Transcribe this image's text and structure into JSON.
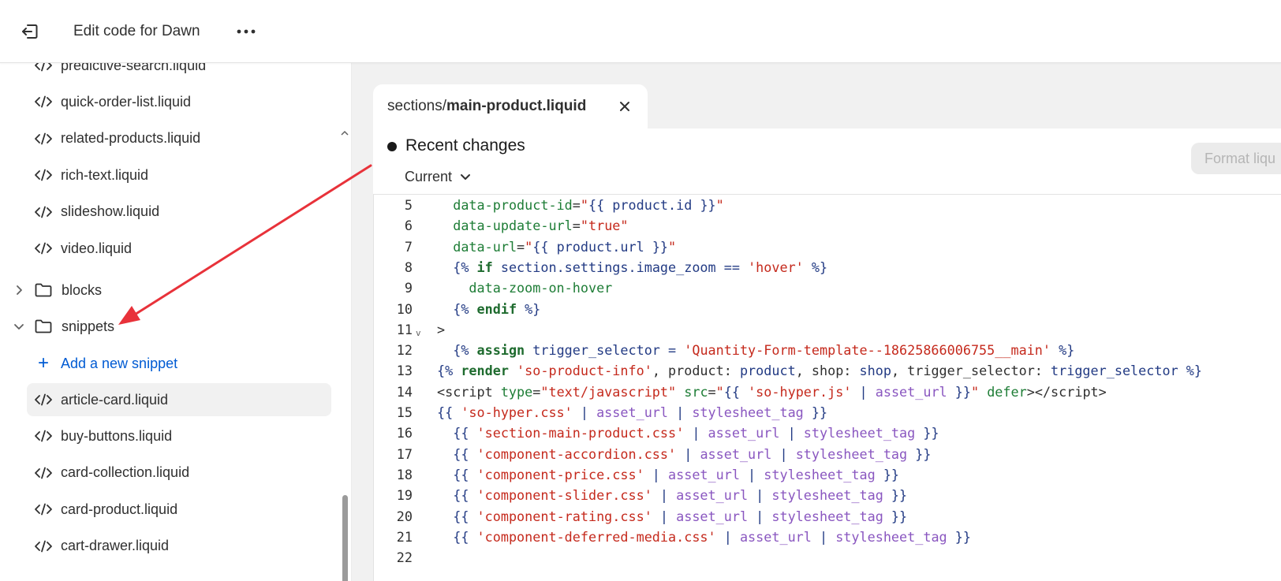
{
  "header": {
    "title": "Edit code for Dawn"
  },
  "sidebar": {
    "files_top": [
      "predictive-search.liquid",
      "quick-order-list.liquid",
      "related-products.liquid",
      "rich-text.liquid",
      "slideshow.liquid",
      "video.liquid"
    ],
    "folders": [
      {
        "name": "blocks",
        "state": "collapsed"
      },
      {
        "name": "snippets",
        "state": "expanded"
      }
    ],
    "add_snippet_label": "Add a new snippet",
    "snippet_files": [
      "article-card.liquid",
      "buy-buttons.liquid",
      "card-collection.liquid",
      "card-product.liquid",
      "cart-drawer.liquid"
    ],
    "selected_file": "article-card.liquid"
  },
  "tab": {
    "dir": "sections/",
    "file": "main-product.liquid"
  },
  "changes": {
    "title": "Recent changes",
    "version": "Current",
    "format_button": "Format liqu"
  },
  "code_lines": [
    {
      "n": "5",
      "fold": "",
      "html": "  <span class=\"t-attr\">data-product-id</span>=<span class=\"t-str\">\"</span><span class=\"t-liq\">{{ product.id }}</span><span class=\"t-str\">\"</span>"
    },
    {
      "n": "6",
      "fold": "",
      "html": "  <span class=\"t-attr\">data-update-url</span>=<span class=\"t-str\">\"true\"</span>"
    },
    {
      "n": "7",
      "fold": "",
      "html": "  <span class=\"t-attr\">data-url</span>=<span class=\"t-str\">\"</span><span class=\"t-liq\">{{ product.url }}</span><span class=\"t-str\">\"</span>"
    },
    {
      "n": "8",
      "fold": "",
      "html": "  <span class=\"t-liq\">{% </span><span class=\"t-kw\">if</span><span class=\"t-liq\"> section.settings.image_zoom == </span><span class=\"t-str\">'hover'</span><span class=\"t-liq\"> %}</span>"
    },
    {
      "n": "9",
      "fold": "",
      "html": "    <span class=\"t-attr\">data-zoom-on-hover</span>"
    },
    {
      "n": "10",
      "fold": "",
      "html": "  <span class=\"t-liq\">{% </span><span class=\"t-kw\">endif</span><span class=\"t-liq\"> %}</span>"
    },
    {
      "n": "11",
      "fold": "v",
      "html": "<span class=\"t-txt\">&gt;</span>"
    },
    {
      "n": "12",
      "fold": "",
      "html": "  <span class=\"t-liq\">{% </span><span class=\"t-kw\">assign</span><span class=\"t-liq\"> trigger_selector = </span><span class=\"t-str\">'Quantity-Form-template--18625866006755__main'</span><span class=\"t-liq\"> %}</span>"
    },
    {
      "n": "13",
      "fold": "",
      "html": "<span class=\"t-liq\">{% </span><span class=\"t-kw\">render</span> <span class=\"t-str\">'so-product-info'</span><span class=\"t-txt\">, product: </span><span class=\"t-liq\">product</span><span class=\"t-txt\">, shop: </span><span class=\"t-liq\">shop</span><span class=\"t-txt\">, trigger_selector: </span><span class=\"t-liq\">trigger_selector %}</span>"
    },
    {
      "n": "14",
      "fold": "",
      "html": "<span class=\"t-txt\">&lt;script </span><span class=\"t-attr\">type</span>=<span class=\"t-str\">\"text/javascript\"</span> <span class=\"t-attr\">src</span>=<span class=\"t-str\">\"</span><span class=\"t-liq\">{{ </span><span class=\"t-str\">'so-hyper.js'</span><span class=\"t-liq\"> | </span><span class=\"t-filter\">asset_url</span><span class=\"t-liq\"> }}</span><span class=\"t-str\">\"</span> <span class=\"t-attr\">defer</span><span class=\"t-txt\">&gt;&lt;/script&gt;</span>"
    },
    {
      "n": "15",
      "fold": "",
      "html": "<span class=\"t-liq\">{{ </span><span class=\"t-str\">'so-hyper.css'</span><span class=\"t-liq\"> | </span><span class=\"t-filter\">asset_url</span><span class=\"t-liq\"> | </span><span class=\"t-filter\">stylesheet_tag</span><span class=\"t-liq\"> }}</span>"
    },
    {
      "n": "16",
      "fold": "",
      "html": "  <span class=\"t-liq\">{{ </span><span class=\"t-str\">'section-main-product.css'</span><span class=\"t-liq\"> | </span><span class=\"t-filter\">asset_url</span><span class=\"t-liq\"> | </span><span class=\"t-filter\">stylesheet_tag</span><span class=\"t-liq\"> }}</span>"
    },
    {
      "n": "17",
      "fold": "",
      "html": "  <span class=\"t-liq\">{{ </span><span class=\"t-str\">'component-accordion.css'</span><span class=\"t-liq\"> | </span><span class=\"t-filter\">asset_url</span><span class=\"t-liq\"> | </span><span class=\"t-filter\">stylesheet_tag</span><span class=\"t-liq\"> }}</span>"
    },
    {
      "n": "18",
      "fold": "",
      "html": "  <span class=\"t-liq\">{{ </span><span class=\"t-str\">'component-price.css'</span><span class=\"t-liq\"> | </span><span class=\"t-filter\">asset_url</span><span class=\"t-liq\"> | </span><span class=\"t-filter\">stylesheet_tag</span><span class=\"t-liq\"> }}</span>"
    },
    {
      "n": "19",
      "fold": "",
      "html": "  <span class=\"t-liq\">{{ </span><span class=\"t-str\">'component-slider.css'</span><span class=\"t-liq\"> | </span><span class=\"t-filter\">asset_url</span><span class=\"t-liq\"> | </span><span class=\"t-filter\">stylesheet_tag</span><span class=\"t-liq\"> }}</span>"
    },
    {
      "n": "20",
      "fold": "",
      "html": "  <span class=\"t-liq\">{{ </span><span class=\"t-str\">'component-rating.css'</span><span class=\"t-liq\"> | </span><span class=\"t-filter\">asset_url</span><span class=\"t-liq\"> | </span><span class=\"t-filter\">stylesheet_tag</span><span class=\"t-liq\"> }}</span>"
    },
    {
      "n": "21",
      "fold": "",
      "html": "  <span class=\"t-liq\">{{ </span><span class=\"t-str\">'component-deferred-media.css'</span><span class=\"t-liq\"> | </span><span class=\"t-filter\">asset_url</span><span class=\"t-liq\"> | </span><span class=\"t-filter\">stylesheet_tag</span><span class=\"t-liq\"> }}</span>"
    },
    {
      "n": "22",
      "fold": "",
      "html": ""
    }
  ],
  "colors": {
    "accent_link": "#005bd3",
    "annotation_arrow": "#e8323a",
    "selected_row": "#f1f1f1"
  },
  "icons": [
    "exit-icon",
    "more-icon",
    "code-file-icon",
    "folder-icon",
    "chevron-right-icon",
    "chevron-down-icon",
    "plus-icon",
    "close-icon"
  ]
}
